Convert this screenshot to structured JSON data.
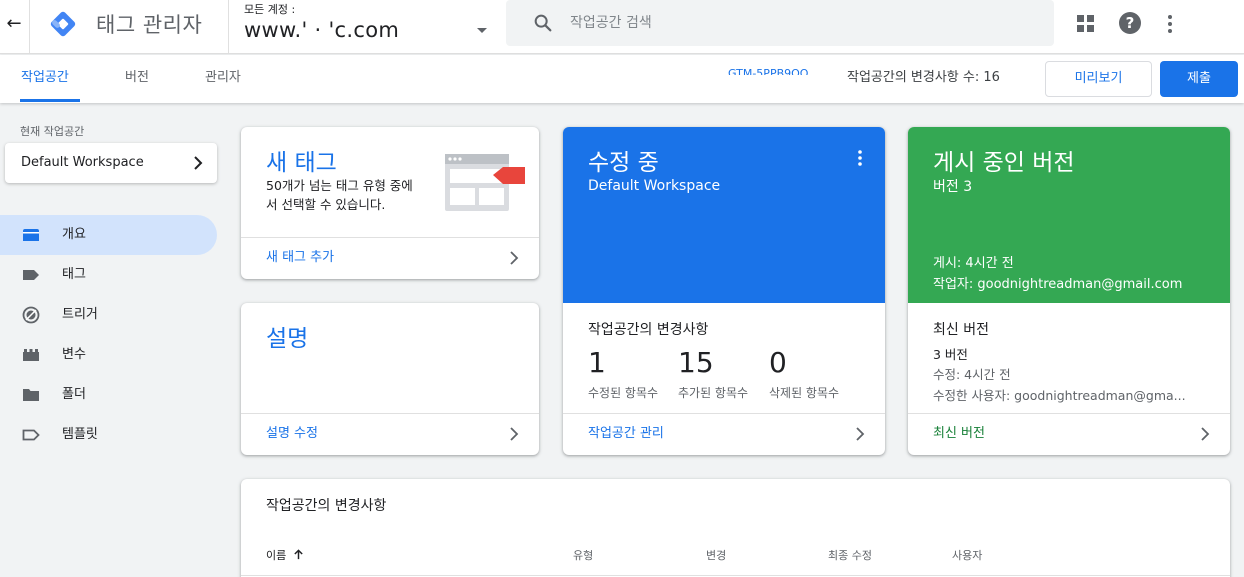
{
  "header": {
    "back_icon": "arrow-left-icon",
    "app_title": "태그 관리자",
    "account_label": "모든 계정 :",
    "account_name": "www.'   ·    'c.com",
    "search_placeholder": "작업공간 검색",
    "icons": [
      "apps-icon",
      "help-icon",
      "more-vert-icon"
    ]
  },
  "nav": {
    "tabs": [
      {
        "label": "작업공간",
        "active": true
      },
      {
        "label": "버전",
        "active": false
      },
      {
        "label": "관리자",
        "active": false
      }
    ],
    "container_id": "GTM-5PPB9QQ",
    "change_count": "작업공간의 변경사항 수: 16",
    "preview_label": "미리보기",
    "submit_label": "제출"
  },
  "sidebar": {
    "current_workspace_label": "현재 작업공간",
    "workspace_name": "Default Workspace",
    "items": [
      {
        "label": "개요",
        "icon": "overview-icon",
        "active": true
      },
      {
        "label": "태그",
        "icon": "tag-icon",
        "active": false
      },
      {
        "label": "트리거",
        "icon": "trigger-icon",
        "active": false
      },
      {
        "label": "변수",
        "icon": "variable-icon",
        "active": false
      },
      {
        "label": "폴더",
        "icon": "folder-icon",
        "active": false
      },
      {
        "label": "템플릿",
        "icon": "template-icon",
        "active": false
      }
    ]
  },
  "cards": {
    "new_tag": {
      "title": "새 태그",
      "desc": "50개가 넘는 태그 유형 중에서 선택할 수 있습니다.",
      "link": "새 태그 추가"
    },
    "description": {
      "title": "설명",
      "link": "설명 수정"
    },
    "editing": {
      "title": "수정 중",
      "workspace": "Default Workspace",
      "stats_title": "작업공간의 변경사항",
      "stats": [
        {
          "value": "1",
          "label": "수정된 항목수"
        },
        {
          "value": "15",
          "label": "추가된 항목수"
        },
        {
          "value": "0",
          "label": "삭제된 항목수"
        }
      ],
      "link": "작업공간 관리"
    },
    "published": {
      "title": "게시 중인 버전",
      "version": "버전 3",
      "published_at": "게시: 4시간 전",
      "author": "작업자: goodnightreadman@gmail.com",
      "latest_title": "최신 버전",
      "latest_version": "3 버전",
      "latest_modified": "수정: 4시간 전",
      "latest_modifier": "수정한 사용자: goodnightreadman@gma...",
      "link": "최신 버전"
    },
    "changes": {
      "title": "작업공간의 변경사항",
      "columns": [
        "이름",
        "유형",
        "변경",
        "최종 수정",
        "사용자"
      ],
      "sort_icon": "arrow-up-icon"
    }
  },
  "colors": {
    "accent": "#1a73e8",
    "editing_bg": "#1a73e8",
    "published_bg": "#34a853",
    "active_nav_bg": "#d2e3fc"
  }
}
